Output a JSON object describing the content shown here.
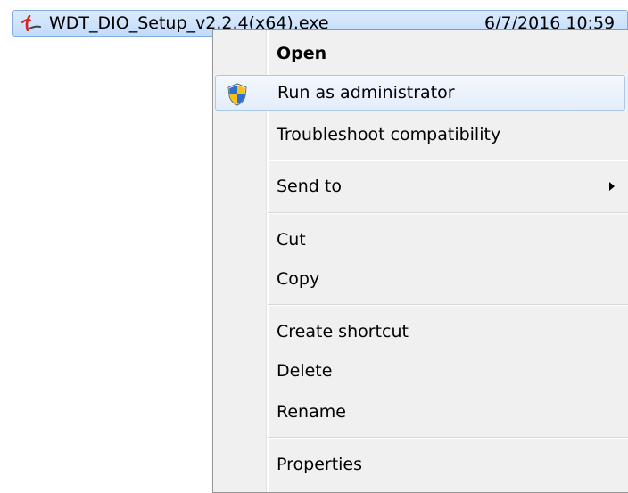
{
  "file": {
    "name": "WDT_DIO_Setup_v2.2.4(x64).exe",
    "modified": "6/7/2016 10:59"
  },
  "context_menu": {
    "items": [
      {
        "label": "Open",
        "bold": true
      },
      {
        "label": "Run as administrator",
        "icon": "uac-shield-icon",
        "highlighted": true
      },
      {
        "label": "Troubleshoot compatibility"
      },
      {
        "label": "Send to",
        "submenu": true
      },
      {
        "label": "Cut"
      },
      {
        "label": "Copy"
      },
      {
        "label": "Create shortcut"
      },
      {
        "label": "Delete"
      },
      {
        "label": "Rename"
      },
      {
        "label": "Properties"
      }
    ]
  },
  "colors": {
    "selection_border": "#84acdd",
    "menu_background": "#f0f0f0",
    "highlight_border": "#a8c8ec"
  }
}
